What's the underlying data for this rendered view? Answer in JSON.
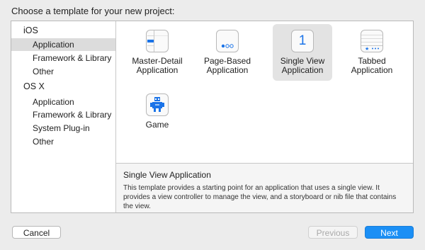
{
  "heading": "Choose a template for your new project:",
  "sidebar": {
    "groups": [
      {
        "platform": "iOS",
        "items": [
          {
            "label": "Application",
            "selected": true
          },
          {
            "label": "Framework & Library"
          },
          {
            "label": "Other"
          }
        ]
      },
      {
        "platform": "OS X",
        "items": [
          {
            "label": "Application"
          },
          {
            "label": "Framework & Library"
          },
          {
            "label": "System Plug-in"
          },
          {
            "label": "Other"
          }
        ]
      }
    ]
  },
  "templates": [
    {
      "label_line1": "Master-Detail",
      "label_line2": "Application",
      "icon": "master-detail-icon"
    },
    {
      "label_line1": "Page-Based",
      "label_line2": "Application",
      "icon": "page-based-icon"
    },
    {
      "label_line1": "Single View",
      "label_line2": "Application",
      "icon": "single-view-icon",
      "icon_text": "1",
      "selected": true
    },
    {
      "label_line1": "Tabbed",
      "label_line2": "Application",
      "icon": "tabbed-icon"
    },
    {
      "label_line1": "Game",
      "label_line2": "",
      "icon": "game-icon"
    }
  ],
  "description": {
    "title": "Single View Application",
    "body": "This template provides a starting point for an application that uses a single view. It provides a view controller to manage the view, and a storyboard or nib file that contains the view."
  },
  "buttons": {
    "cancel": "Cancel",
    "previous": "Previous",
    "next": "Next"
  },
  "colors": {
    "accent": "#1b8ff5",
    "icon_blue": "#1a73e8"
  }
}
